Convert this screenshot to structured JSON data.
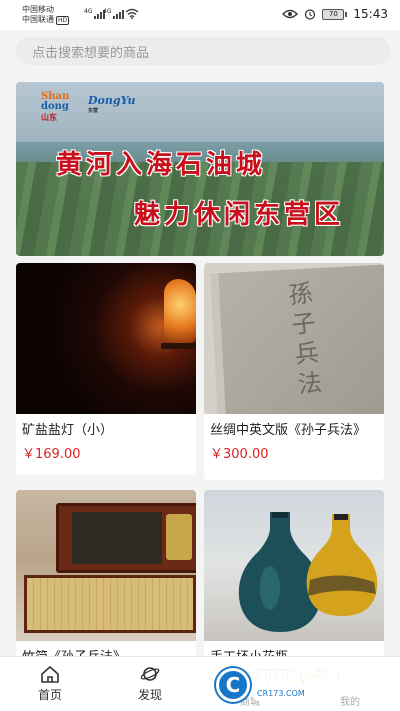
{
  "status_bar": {
    "carrier1": "中国移动",
    "carrier2": "中国联通",
    "hd": "HD",
    "net1": "4G",
    "net2": "4G",
    "battery": "70",
    "time": "15:43"
  },
  "search": {
    "placeholder": "点击搜索想要的商品"
  },
  "banner": {
    "line1": "黄河入海石油城",
    "line2": "魅力休闲东营区",
    "logo_shandong_line1": "Shan",
    "logo_shandong_line2": "dong",
    "logo_shandong_cn": "山东",
    "logo_dongying": "DongYu",
    "logo_dongying_sub": "东营"
  },
  "products": [
    {
      "name": "矿盐盐灯（小）",
      "price": "￥169.00"
    },
    {
      "name": "丝绸中英文版《孙子兵法》",
      "price": "￥300.00",
      "cover_title": "孫子兵法"
    },
    {
      "name": "竹简《孙子兵法》",
      "price": ""
    },
    {
      "name": "手工坯小花瓶",
      "price": ""
    }
  ],
  "bottom_nav": {
    "home": "首页",
    "discover": "发现",
    "mall": "商城",
    "mine": "我的"
  },
  "watermark": {
    "logo_letter": "C",
    "main1": "西西",
    "main2": "软件园",
    "sub": "CR173.COM"
  },
  "colors": {
    "price": "#e02020",
    "banner_text": "#c80f1b",
    "watermark_blue": "#1677c7"
  }
}
